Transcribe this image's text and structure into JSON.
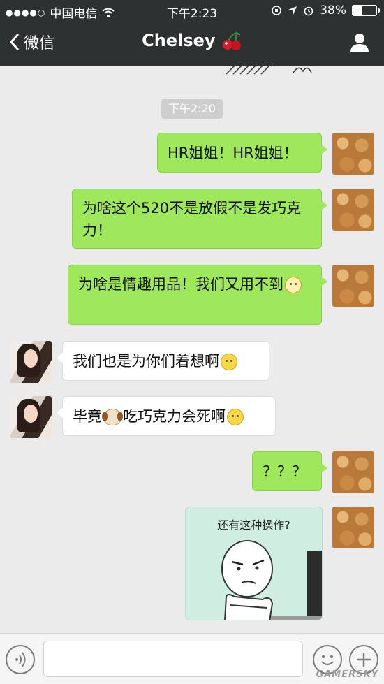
{
  "status_bar": {
    "carrier": "中国电信",
    "time": "下午2:23",
    "battery": "38%",
    "battery_level": 0.38
  },
  "nav": {
    "back_label": "微信",
    "title": "Chelsey",
    "title_icon": "cherry-icon",
    "right_icon": "person-icon"
  },
  "chat": {
    "timestamp": "下午2:20",
    "messages": [
      {
        "side": "me",
        "text": "HR姐姐！HR姐姐！"
      },
      {
        "side": "me",
        "text": "为啥这个520不是放假不是发巧克力！"
      },
      {
        "side": "me",
        "text": "为啥是情趣用品！我们又用不到",
        "emoji": "sad-face-emoji"
      },
      {
        "side": "them",
        "text": "我们也是为你们着想啊",
        "emoji": "smile-emoji"
      },
      {
        "side": "them",
        "text_before": "毕竟",
        "inline_emoji": "dog-emoji",
        "text_after": "吃巧克力会死啊",
        "emoji": "smile-emoji"
      },
      {
        "side": "me",
        "text": "？？？"
      },
      {
        "side": "me",
        "type": "sticker",
        "caption": "还有这种操作?"
      }
    ]
  },
  "input_bar": {
    "value": "",
    "left_icon": "voice-icon",
    "icons": [
      "emoji-icon",
      "plus-icon"
    ]
  },
  "watermark": "GAMERSKY",
  "colors": {
    "nav_bg": "#2e3132",
    "chat_bg": "#ebebeb",
    "my_bubble": "#9fe85b",
    "their_bubble": "#ffffff"
  }
}
